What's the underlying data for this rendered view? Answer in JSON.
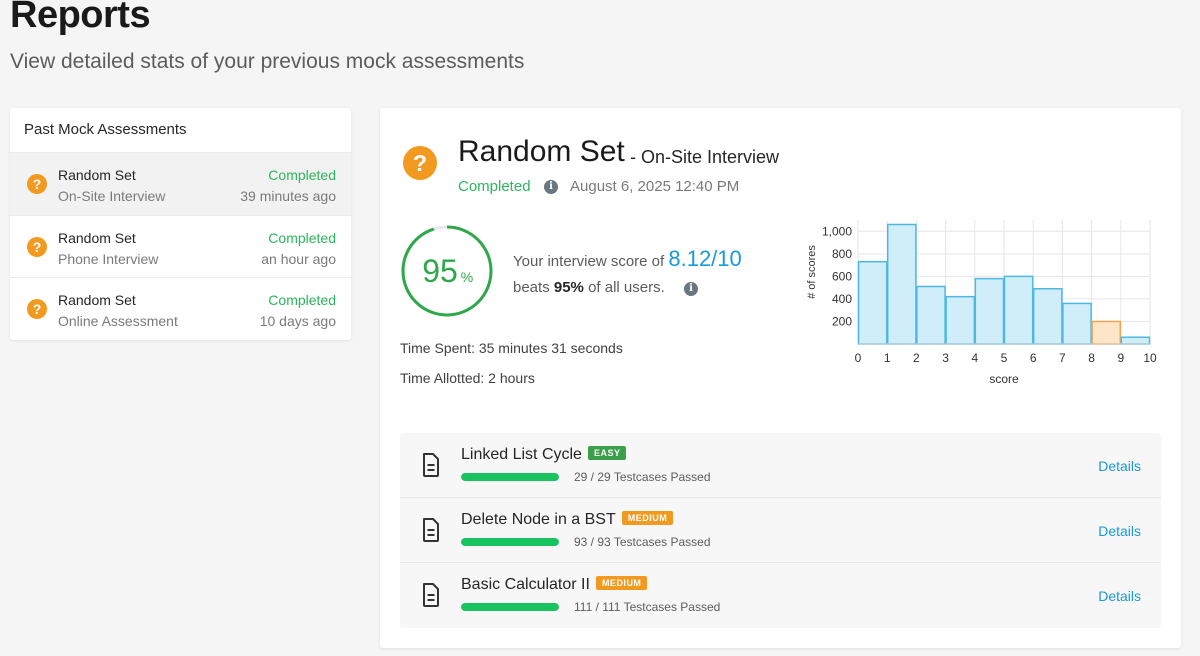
{
  "header": {
    "title": "Reports",
    "subtitle": "View detailed stats of your previous mock assessments"
  },
  "sidebar": {
    "heading": "Past Mock Assessments",
    "items": [
      {
        "title": "Random Set",
        "type": "On-Site Interview",
        "status": "Completed",
        "time": "39 minutes ago",
        "active": true
      },
      {
        "title": "Random Set",
        "type": "Phone Interview",
        "status": "Completed",
        "time": "an hour ago",
        "active": false
      },
      {
        "title": "Random Set",
        "type": "Online Assessment",
        "status": "Completed",
        "time": "10 days ago",
        "active": false
      }
    ]
  },
  "detail": {
    "title": "Random Set",
    "type": "- On-Site Interview",
    "status": "Completed",
    "date": "August 6, 2025 12:40 PM",
    "percent": "95",
    "percent_symbol": "%",
    "percent_value": 95,
    "score_prefix": "Your interview score of",
    "score": "8.12/10",
    "beats_prefix": "beats",
    "beats_value": "95%",
    "beats_suffix": "of all users.",
    "time_spent": "Time Spent: 35 minutes 31 seconds",
    "time_allotted": "Time Allotted: 2 hours"
  },
  "chart_data": {
    "type": "bar",
    "xlabel": "score",
    "ylabel": "# of scores",
    "x_ticks": [
      "0",
      "1",
      "2",
      "3",
      "4",
      "5",
      "6",
      "7",
      "8",
      "9",
      "10"
    ],
    "y_ticks": [
      "200",
      "400",
      "600",
      "800",
      "1,000"
    ],
    "ylim": [
      0,
      1100
    ],
    "bin_edges": [
      0,
      1,
      2,
      3,
      4,
      5,
      6,
      7,
      8,
      9,
      10
    ],
    "values": [
      730,
      1060,
      510,
      420,
      580,
      600,
      490,
      360,
      200,
      60
    ],
    "highlight_bin": 8,
    "colors": {
      "bar": "#cfeef9",
      "bar_stroke": "#4fb8e0",
      "highlight": "#fde5c8",
      "highlight_stroke": "#f0a450"
    }
  },
  "questions": [
    {
      "name": "Linked List Cycle",
      "difficulty": "EASY",
      "level": "easy",
      "tests": "29 / 29 Testcases Passed",
      "progress": 1.0,
      "details": "Details"
    },
    {
      "name": "Delete Node in a BST",
      "difficulty": "MEDIUM",
      "level": "medium",
      "tests": "93 / 93 Testcases Passed",
      "progress": 1.0,
      "details": "Details"
    },
    {
      "name": "Basic Calculator II",
      "difficulty": "MEDIUM",
      "level": "medium",
      "tests": "111 / 111 Testcases Passed",
      "progress": 1.0,
      "details": "Details"
    }
  ],
  "colors": {
    "accent": "#1a9ad6",
    "success": "#2db55d",
    "warning": "#f29a1f"
  }
}
